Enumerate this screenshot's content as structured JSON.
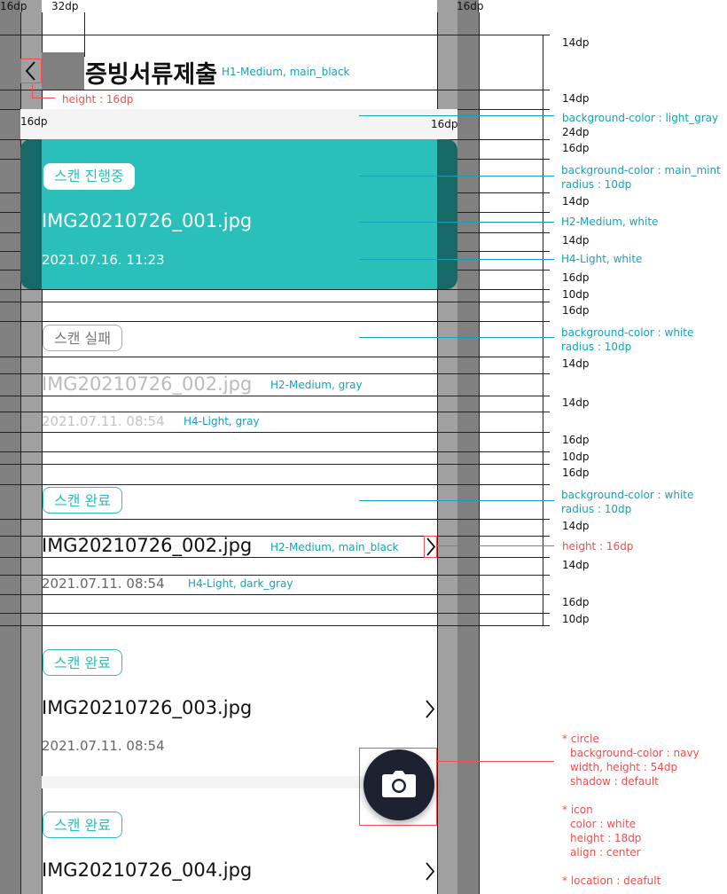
{
  "top_dims": {
    "left": "16dp",
    "icon": "32dp",
    "right": "16dp"
  },
  "header": {
    "title": "증빙서류제출",
    "title_ann": "H1-Medium, main_black",
    "back_ann": "height : 16dp"
  },
  "section_ann": {
    "left": "16dp",
    "right": "16dp",
    "bg": "background-color : light_gray"
  },
  "cards": [
    {
      "badge": "스캔 진행중",
      "filename": "IMG20210726_001.jpg",
      "date": "2021.07.16. 11:23",
      "badge_ann": [
        "background-color : main_mint",
        "radius : 10dp"
      ],
      "filename_ann": "H2-Medium, white",
      "date_ann": "H4-Light, white"
    },
    {
      "badge": "스캔 실패",
      "filename": "IMG20210726_002.jpg",
      "date": "2021.07.11. 08:54",
      "badge_ann": [
        "background-color : white",
        "radius : 10dp"
      ],
      "filename_ann": "H2-Medium, gray",
      "date_ann": "H4-Light, gray"
    },
    {
      "badge": "스캔 완료",
      "filename": "IMG20210726_002.jpg",
      "date": "2021.07.11. 08:54",
      "badge_ann": [
        "background-color : white",
        "radius : 10dp"
      ],
      "filename_ann": "H2-Medium, main_black",
      "date_ann": "H4-Light, dark_gray",
      "arrow_ann": "height : 16dp"
    },
    {
      "badge": "스캔 완료",
      "filename": "IMG20210726_003.jpg",
      "date": "2021.07.11. 08:54"
    },
    {
      "badge": "스캔 완료",
      "filename": "IMG20210726_004.jpg"
    }
  ],
  "right_dims": [
    "14dp",
    "14dp",
    "24dp",
    "16dp",
    "14dp",
    "14dp",
    "16dp",
    "10dp",
    "16dp",
    "14dp",
    "14dp",
    "16dp",
    "10dp",
    "16dp",
    "14dp",
    "14dp",
    "16dp",
    "10dp"
  ],
  "fab_ann": {
    "circle": [
      "* circle",
      "background-color : navy",
      "width, height : 54dp",
      "shadow : default"
    ],
    "icon": [
      "* icon",
      "color : white",
      "height : 18dp",
      "align : center"
    ],
    "location": "* location : deafult"
  },
  "fab_icon": "camera-icon",
  "colors": {
    "main_mint": "#2bbfb9",
    "navy": "#1c2230",
    "annotation": "#12a3b8",
    "red": "#ef4f4f"
  }
}
